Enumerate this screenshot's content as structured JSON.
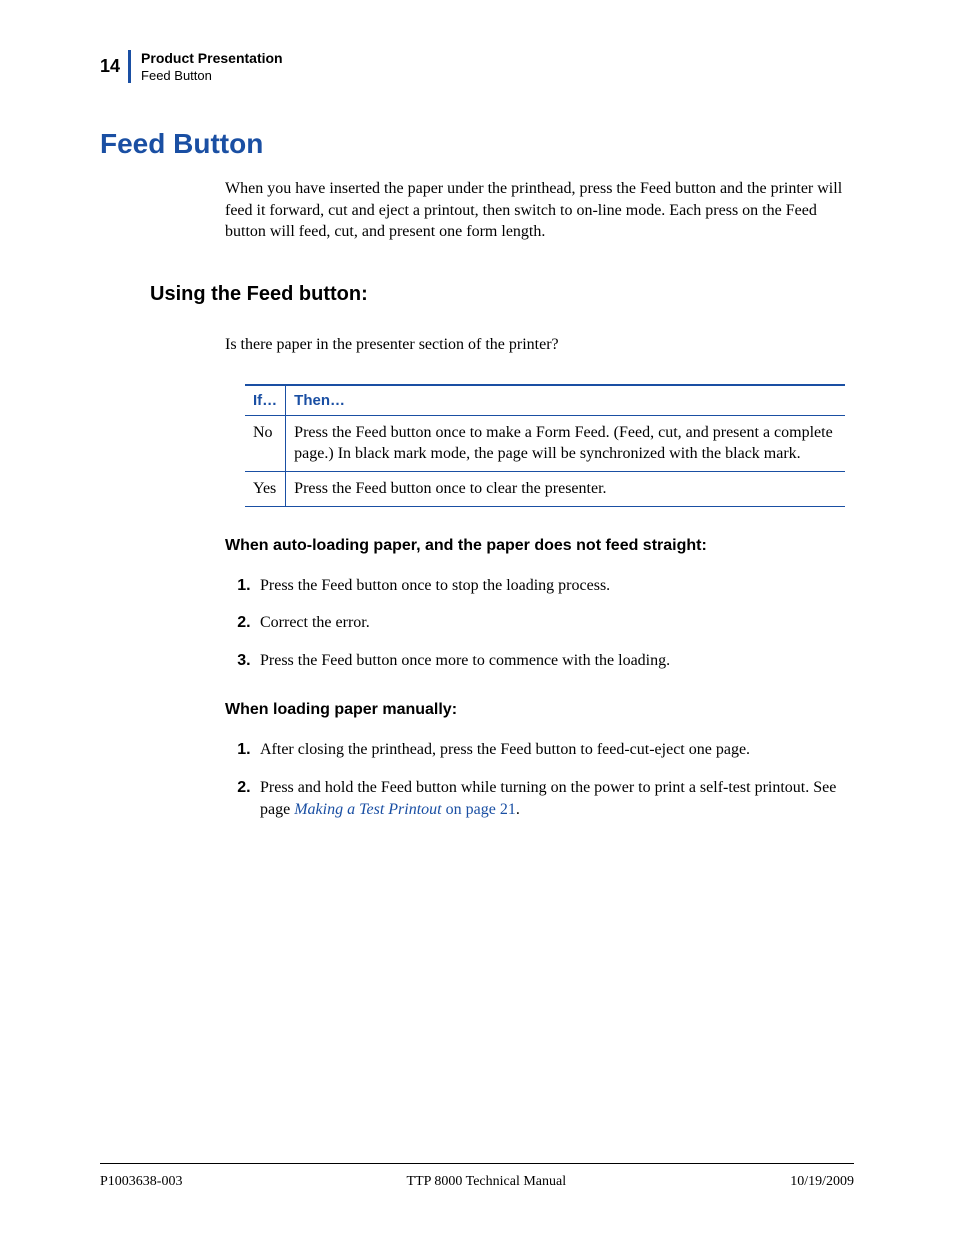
{
  "header": {
    "page_number": "14",
    "chapter": "Product Presentation",
    "section": "Feed Button"
  },
  "h1": "Feed Button",
  "intro": "When you have inserted the paper under the printhead, press the Feed button and the printer will feed it forward, cut and eject a printout, then switch to on-line mode. Each press on the Feed button will feed, cut, and present one form length.",
  "h2": "Using the Feed button:",
  "question": "Is there paper in the presenter section of the printer?",
  "table": {
    "head_if": "If…",
    "head_then": "Then…",
    "rows": [
      {
        "if": "No",
        "then": "Press the Feed button once to make a Form Feed. (Feed, cut, and present a complete page.) In black mark mode, the page will be synchronized with the black mark."
      },
      {
        "if": "Yes",
        "then": "Press the Feed button once to clear the presenter."
      }
    ]
  },
  "h3a": "When auto-loading paper, and the paper does not feed straight:",
  "list_a": [
    "Press the Feed button once to stop the loading process.",
    "Correct the error.",
    "Press the Feed button once more to commence with the loading."
  ],
  "h3b": "When loading paper manually:",
  "list_b_1": "After closing the printhead, press the Feed button to feed-cut-eject one page.",
  "list_b_2_pre": "Press and hold the Feed button while turning on the power to print a self-test printout. See page ",
  "list_b_2_link_italic": "Making a Test Printout",
  "list_b_2_link_plain": " on page 21",
  "list_b_2_post": ".",
  "footer": {
    "left": "P1003638-003",
    "center": "TTP 8000 Technical Manual",
    "right": "10/19/2009"
  }
}
